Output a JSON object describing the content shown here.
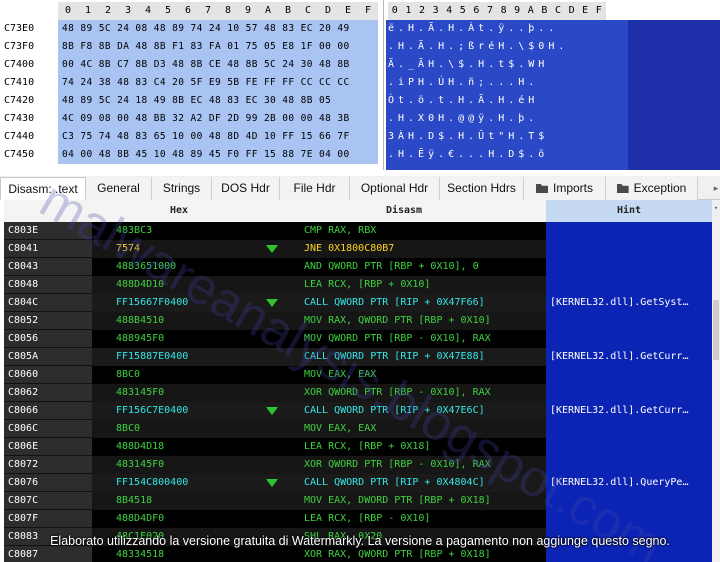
{
  "hex_view": {
    "columns": [
      "0",
      "1",
      "2",
      "3",
      "4",
      "5",
      "6",
      "7",
      "8",
      "9",
      "A",
      "B",
      "C",
      "D",
      "E",
      "F"
    ],
    "rows": [
      {
        "addr": "C73E0",
        "bytes": "48 89 5C 24 08 48 89 74 24 10 57 48 83 EC 20 49"
      },
      {
        "addr": "C73F0",
        "bytes": "8B F8 8B DA 48 8B F1 83 FA 01 75 05 E8 1F 00 00"
      },
      {
        "addr": "C7400",
        "bytes": "00 4C 8B C7 8B D3 48 8B CE 48 8B 5C 24 30 48 8B"
      },
      {
        "addr": "C7410",
        "bytes": "74 24 38 48 83 C4 20 5F E9 5B FE FF FF CC CC CC"
      },
      {
        "addr": "C7420",
        "bytes": "48 89 5C 24 18 49 8B EC 48 83 EC 30 48 8B 05"
      },
      {
        "addr": "C7430",
        "bytes": "4C 09 08 00 48 BB 32 A2 DF 2D 99 2B 00 00 48 3B"
      },
      {
        "addr": "C7440",
        "bytes": "C3 75 74 48 83 65 10 00 48 8D 4D 10 FF 15 66 7F"
      },
      {
        "addr": "C7450",
        "bytes": "04 00 48 8B 45 10 48 89 45 F0 FF 15 88 7E 04 00"
      }
    ]
  },
  "ascii_view": {
    "columns": [
      "0",
      "1",
      "2",
      "3",
      "4",
      "5",
      "6",
      "7",
      "8",
      "9",
      "A",
      "B",
      "C",
      "D",
      "E",
      "F"
    ],
    "rows": [
      "ë.H.Ã.H.Àt.ÿ..þ..",
      ".H.Ã.H.;ßréH.\\$0H.",
      "Ä._ÃH.\\$.H.t$.WH",
      ".iPH.ÚH.ñ;...H.",
      "Òt.ö.t.H.Ã.H.éH",
      ".H.X0H.@@ÿ.H.þ.",
      "3ÀH.D$.H.Ût\"H.T$",
      ".H.Ëÿ.€...H.D$.ö"
    ]
  },
  "tabs": [
    {
      "label": "Disasm: .text",
      "active": true
    },
    {
      "label": "General"
    },
    {
      "label": "Strings"
    },
    {
      "label": "DOS Hdr"
    },
    {
      "label": "File Hdr"
    },
    {
      "label": "Optional Hdr"
    },
    {
      "label": "Section Hdrs"
    },
    {
      "label": "Imports",
      "icon": "folder-icon"
    },
    {
      "label": "Exception",
      "icon": "folder-icon"
    }
  ],
  "grid": {
    "headers": {
      "hex": "Hex",
      "disasm": "Disasm",
      "hint": "Hint"
    },
    "rows": [
      {
        "addr": "C803E",
        "hex": "483BC3",
        "dis": "CMP RAX, RBX",
        "hint": "",
        "kind": "normal"
      },
      {
        "addr": "C8041",
        "hex": "7574",
        "dis": "JNE 0X1800C80B7",
        "hint": "",
        "kind": "jmp",
        "arrow": true
      },
      {
        "addr": "C8043",
        "hex": "4883651000",
        "dis": "AND QWORD PTR [RBP + 0X10], 0",
        "hint": "",
        "kind": "normal"
      },
      {
        "addr": "C8048",
        "hex": "488D4D10",
        "dis": "LEA RCX, [RBP + 0X10]",
        "hint": "",
        "kind": "normal"
      },
      {
        "addr": "C804C",
        "hex": "FF15667F0400",
        "dis": "CALL QWORD PTR [RIP + 0X47F66]",
        "hint": "[KERNEL32.dll].GetSyst…",
        "kind": "call",
        "arrow": true
      },
      {
        "addr": "C8052",
        "hex": "488B4510",
        "dis": "MOV RAX, QWORD PTR [RBP + 0X10]",
        "hint": "",
        "kind": "normal"
      },
      {
        "addr": "C8056",
        "hex": "488945F0",
        "dis": "MOV QWORD PTR [RBP - 0X10], RAX",
        "hint": "",
        "kind": "normal"
      },
      {
        "addr": "C805A",
        "hex": "FF15887E0400",
        "dis": "CALL QWORD PTR [RIP + 0X47E88]",
        "hint": "[KERNEL32.dll].GetCurr…",
        "kind": "call"
      },
      {
        "addr": "C8060",
        "hex": "8BC0",
        "dis": "MOV EAX, EAX",
        "hint": "",
        "kind": "normal"
      },
      {
        "addr": "C8062",
        "hex": "483145F0",
        "dis": "XOR QWORD PTR [RBP - 0X10], RAX",
        "hint": "",
        "kind": "normal"
      },
      {
        "addr": "C8066",
        "hex": "FF156C7E0400",
        "dis": "CALL QWORD PTR [RIP + 0X47E6C]",
        "hint": "[KERNEL32.dll].GetCurr…",
        "kind": "call",
        "arrow": true
      },
      {
        "addr": "C806C",
        "hex": "8BC0",
        "dis": "MOV EAX, EAX",
        "hint": "",
        "kind": "normal"
      },
      {
        "addr": "C806E",
        "hex": "488D4D18",
        "dis": "LEA RCX, [RBP + 0X18]",
        "hint": "",
        "kind": "normal"
      },
      {
        "addr": "C8072",
        "hex": "483145F0",
        "dis": "XOR QWORD PTR [RBP - 0X10], RAX",
        "hint": "",
        "kind": "normal"
      },
      {
        "addr": "C8076",
        "hex": "FF154C800400",
        "dis": "CALL QWORD PTR [RIP + 0X4804C]",
        "hint": "[KERNEL32.dll].QueryPe…",
        "kind": "call",
        "arrow": true
      },
      {
        "addr": "C807C",
        "hex": "8B4518",
        "dis": "MOV EAX, DWORD PTR [RBP + 0X18]",
        "hint": "",
        "kind": "normal"
      },
      {
        "addr": "C807F",
        "hex": "488D4DF0",
        "dis": "LEA RCX, [RBP - 0X10]",
        "hint": "",
        "kind": "normal"
      },
      {
        "addr": "C8083",
        "hex": "48C1E020",
        "dis": "SHL RAX, 0X20",
        "hint": "",
        "kind": "normal"
      },
      {
        "addr": "C8087",
        "hex": "48334518",
        "dis": "XOR RAX, QWORD PTR [RBP + 0X18]",
        "hint": "",
        "kind": "normal"
      }
    ]
  },
  "watermark": "malwareanalysis.blogspot.com",
  "notice": "Elaborato utilizzando la versione gratuita di Watermarkly. La versione a pagamento non aggiunge questo segno."
}
